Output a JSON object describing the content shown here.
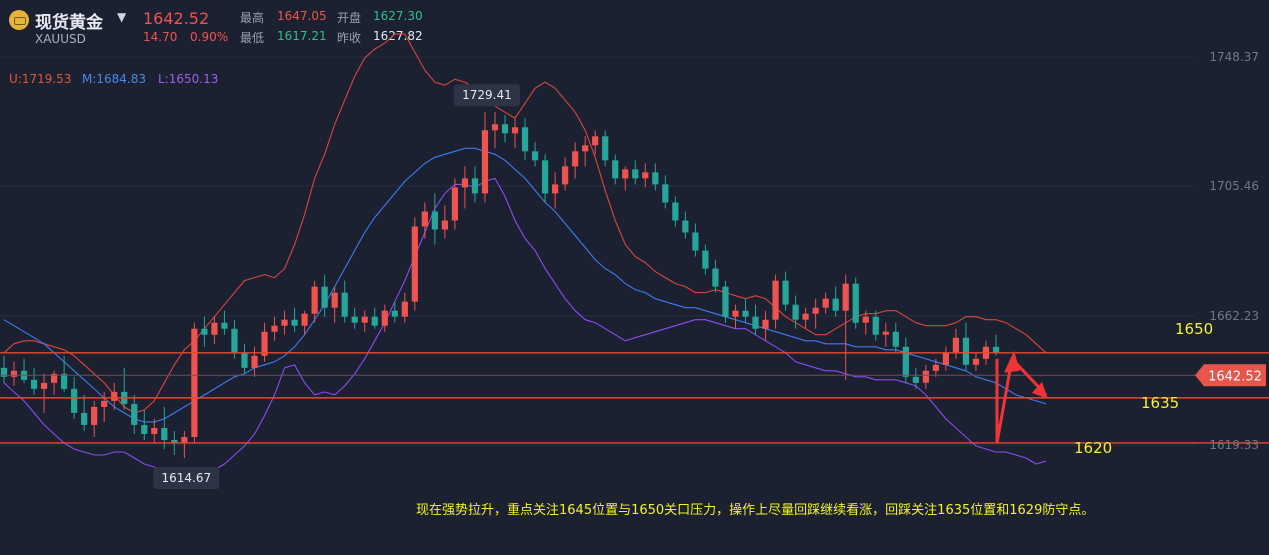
{
  "header": {
    "title": "现货黄金",
    "symbol": "XAUUSD",
    "price": "1642.52",
    "change": "14.70",
    "change_pct": "0.90%",
    "high_label": "最高",
    "high": "1647.05",
    "open_label": "开盘",
    "open": "1627.30",
    "low_label": "最低",
    "low": "1617.21",
    "prev_close_label": "昨收",
    "prev_close": "1627.82"
  },
  "boll": {
    "upper": "U:1719.53",
    "mid": "M:1684.83",
    "lower": "L:1650.13"
  },
  "colors": {
    "up": "#ef5350",
    "down": "#26a69a",
    "upper_band": "#d8473c",
    "mid_band": "#3c7cf0",
    "lower_band": "#8a4cf0",
    "annotation": "#f6f32a"
  },
  "callouts": {
    "max": "1729.41",
    "min": "1614.67"
  },
  "level_labels": {
    "l1650": "1650",
    "l1635": "1635",
    "l1620": "1620"
  },
  "price_tag": "1642.52",
  "note": "现在强势拉升，重点关注1645位置与1650关口压力，操作上尽量回踩继续看涨，回踩关注1635位置和1629防守点。",
  "chart_data": {
    "type": "candlestick",
    "yticks": [
      1748.37,
      1705.46,
      1662.23,
      1619.33
    ],
    "ytick_labels": [
      "1748.37",
      "1705.46",
      "1662.23",
      "1619.33"
    ],
    "ylim": [
      1603,
      1760
    ],
    "levels": [
      1650,
      1635,
      1620
    ],
    "last_price": 1642.52,
    "series": [
      {
        "name": "U",
        "values": [
          1650,
          1653,
          1654,
          1654,
          1653,
          1652,
          1651,
          1649,
          1646,
          1643,
          1640,
          1636,
          1632,
          1630,
          1631,
          1634,
          1640,
          1646,
          1651,
          1654,
          1658,
          1662,
          1666,
          1670,
          1674,
          1675,
          1676,
          1675,
          1678,
          1686,
          1696,
          1708,
          1716,
          1726,
          1734,
          1742,
          1748,
          1751,
          1753,
          1756,
          1756,
          1750,
          1744,
          1740,
          1739,
          1741,
          1740,
          1738,
          1735,
          1732,
          1730,
          1728,
          1733,
          1738,
          1740,
          1738,
          1734,
          1730,
          1724,
          1715,
          1704,
          1694,
          1686,
          1682,
          1680,
          1677,
          1675,
          1673,
          1672,
          1670,
          1670,
          1671,
          1670,
          1669,
          1668,
          1669,
          1668,
          1665,
          1662,
          1660,
          1658,
          1656,
          1656,
          1658,
          1660,
          1662,
          1663,
          1663,
          1664,
          1664,
          1662,
          1660,
          1659,
          1659,
          1659,
          1660,
          1662,
          1662,
          1661,
          1661,
          1660,
          1658,
          1656,
          1653,
          1650
        ]
      },
      {
        "name": "M",
        "values": [
          1661,
          1659,
          1657,
          1655,
          1653,
          1650,
          1647,
          1644,
          1641,
          1638,
          1635,
          1632,
          1630,
          1628,
          1627,
          1627,
          1628,
          1630,
          1632,
          1634,
          1636,
          1638,
          1640,
          1642,
          1643,
          1645,
          1646,
          1647,
          1649,
          1652,
          1656,
          1661,
          1666,
          1672,
          1678,
          1684,
          1690,
          1695,
          1699,
          1703,
          1707,
          1710,
          1713,
          1715,
          1716,
          1717,
          1718,
          1718,
          1717,
          1716,
          1714,
          1711,
          1708,
          1704,
          1700,
          1697,
          1693,
          1689,
          1685,
          1681,
          1678,
          1676,
          1673,
          1671,
          1670,
          1668,
          1667,
          1666,
          1665,
          1665,
          1664,
          1663,
          1662,
          1661,
          1660,
          1659,
          1658,
          1657,
          1656,
          1655,
          1654,
          1654,
          1653,
          1653,
          1653,
          1652,
          1652,
          1652,
          1651,
          1651,
          1650,
          1649,
          1648,
          1647,
          1646,
          1645,
          1644,
          1642,
          1641,
          1640,
          1638,
          1636,
          1635,
          1634,
          1633
        ]
      },
      {
        "name": "L",
        "values": [
          1640,
          1637,
          1634,
          1630,
          1626,
          1623,
          1620,
          1618,
          1617,
          1616,
          1616,
          1617,
          1617,
          1615,
          1613,
          1612,
          1611,
          1611,
          1610,
          1610,
          1610,
          1611,
          1613,
          1616,
          1619,
          1623,
          1629,
          1636,
          1645,
          1646,
          1640,
          1636,
          1637,
          1636,
          1639,
          1643,
          1648,
          1654,
          1660,
          1667,
          1674,
          1682,
          1690,
          1698,
          1703,
          1706,
          1706,
          1705,
          1707,
          1708,
          1702,
          1694,
          1688,
          1684,
          1678,
          1673,
          1668,
          1664,
          1661,
          1660,
          1658,
          1656,
          1654,
          1655,
          1656,
          1657,
          1658,
          1659,
          1660,
          1661,
          1661,
          1660,
          1659,
          1658,
          1658,
          1656,
          1654,
          1652,
          1650,
          1647,
          1646,
          1645,
          1644,
          1644,
          1643,
          1642,
          1642,
          1641,
          1641,
          1641,
          1640,
          1639,
          1636,
          1632,
          1628,
          1625,
          1622,
          1619,
          1618,
          1617,
          1617,
          1616,
          1615,
          1613,
          1614
        ]
      }
    ],
    "candles": [
      {
        "o": 1645,
        "h": 1649,
        "l": 1640,
        "c": 1642
      },
      {
        "o": 1642,
        "h": 1647,
        "l": 1639,
        "c": 1644
      },
      {
        "o": 1644,
        "h": 1648,
        "l": 1640,
        "c": 1641
      },
      {
        "o": 1641,
        "h": 1645,
        "l": 1636,
        "c": 1638
      },
      {
        "o": 1638,
        "h": 1643,
        "l": 1630,
        "c": 1640
      },
      {
        "o": 1640,
        "h": 1644,
        "l": 1636,
        "c": 1643
      },
      {
        "o": 1643,
        "h": 1649,
        "l": 1637,
        "c": 1638
      },
      {
        "o": 1638,
        "h": 1642,
        "l": 1628,
        "c": 1630
      },
      {
        "o": 1630,
        "h": 1636,
        "l": 1624,
        "c": 1626
      },
      {
        "o": 1626,
        "h": 1634,
        "l": 1622,
        "c": 1632
      },
      {
        "o": 1632,
        "h": 1637,
        "l": 1627,
        "c": 1634
      },
      {
        "o": 1634,
        "h": 1640,
        "l": 1631,
        "c": 1637
      },
      {
        "o": 1637,
        "h": 1645,
        "l": 1631,
        "c": 1633
      },
      {
        "o": 1633,
        "h": 1636,
        "l": 1623,
        "c": 1626
      },
      {
        "o": 1626,
        "h": 1631,
        "l": 1621,
        "c": 1623
      },
      {
        "o": 1623,
        "h": 1628,
        "l": 1620,
        "c": 1625
      },
      {
        "o": 1625,
        "h": 1632,
        "l": 1618,
        "c": 1621
      },
      {
        "o": 1621,
        "h": 1624,
        "l": 1616,
        "c": 1620
      },
      {
        "o": 1620,
        "h": 1624,
        "l": 1615,
        "c": 1622
      },
      {
        "o": 1622,
        "h": 1660,
        "l": 1620,
        "c": 1658
      },
      {
        "o": 1658,
        "h": 1662,
        "l": 1652,
        "c": 1656
      },
      {
        "o": 1656,
        "h": 1662,
        "l": 1653,
        "c": 1660
      },
      {
        "o": 1660,
        "h": 1664,
        "l": 1656,
        "c": 1658
      },
      {
        "o": 1658,
        "h": 1661,
        "l": 1648,
        "c": 1650
      },
      {
        "o": 1650,
        "h": 1653,
        "l": 1643,
        "c": 1645
      },
      {
        "o": 1645,
        "h": 1652,
        "l": 1642,
        "c": 1649
      },
      {
        "o": 1649,
        "h": 1660,
        "l": 1647,
        "c": 1657
      },
      {
        "o": 1657,
        "h": 1662,
        "l": 1654,
        "c": 1659
      },
      {
        "o": 1659,
        "h": 1664,
        "l": 1656,
        "c": 1661
      },
      {
        "o": 1661,
        "h": 1665,
        "l": 1657,
        "c": 1659
      },
      {
        "o": 1659,
        "h": 1664,
        "l": 1656,
        "c": 1663
      },
      {
        "o": 1663,
        "h": 1674,
        "l": 1660,
        "c": 1672
      },
      {
        "o": 1672,
        "h": 1676,
        "l": 1662,
        "c": 1665
      },
      {
        "o": 1665,
        "h": 1672,
        "l": 1660,
        "c": 1670
      },
      {
        "o": 1670,
        "h": 1674,
        "l": 1660,
        "c": 1662
      },
      {
        "o": 1662,
        "h": 1665,
        "l": 1658,
        "c": 1660
      },
      {
        "o": 1660,
        "h": 1664,
        "l": 1657,
        "c": 1662
      },
      {
        "o": 1662,
        "h": 1665,
        "l": 1658,
        "c": 1659
      },
      {
        "o": 1659,
        "h": 1666,
        "l": 1657,
        "c": 1664
      },
      {
        "o": 1664,
        "h": 1667,
        "l": 1660,
        "c": 1662
      },
      {
        "o": 1662,
        "h": 1670,
        "l": 1660,
        "c": 1667
      },
      {
        "o": 1667,
        "h": 1695,
        "l": 1664,
        "c": 1692
      },
      {
        "o": 1692,
        "h": 1700,
        "l": 1688,
        "c": 1697
      },
      {
        "o": 1697,
        "h": 1703,
        "l": 1686,
        "c": 1691
      },
      {
        "o": 1691,
        "h": 1699,
        "l": 1688,
        "c": 1694
      },
      {
        "o": 1694,
        "h": 1708,
        "l": 1691,
        "c": 1705
      },
      {
        "o": 1705,
        "h": 1712,
        "l": 1698,
        "c": 1708
      },
      {
        "o": 1708,
        "h": 1712,
        "l": 1700,
        "c": 1703
      },
      {
        "o": 1703,
        "h": 1730,
        "l": 1700,
        "c": 1724
      },
      {
        "o": 1724,
        "h": 1730,
        "l": 1718,
        "c": 1726
      },
      {
        "o": 1726,
        "h": 1729,
        "l": 1720,
        "c": 1723
      },
      {
        "o": 1723,
        "h": 1728,
        "l": 1718,
        "c": 1725
      },
      {
        "o": 1725,
        "h": 1728,
        "l": 1714,
        "c": 1717
      },
      {
        "o": 1717,
        "h": 1720,
        "l": 1712,
        "c": 1714
      },
      {
        "o": 1714,
        "h": 1716,
        "l": 1700,
        "c": 1703
      },
      {
        "o": 1703,
        "h": 1710,
        "l": 1698,
        "c": 1706
      },
      {
        "o": 1706,
        "h": 1715,
        "l": 1704,
        "c": 1712
      },
      {
        "o": 1712,
        "h": 1720,
        "l": 1708,
        "c": 1717
      },
      {
        "o": 1717,
        "h": 1722,
        "l": 1712,
        "c": 1719
      },
      {
        "o": 1719,
        "h": 1724,
        "l": 1716,
        "c": 1722
      },
      {
        "o": 1722,
        "h": 1724,
        "l": 1712,
        "c": 1714
      },
      {
        "o": 1714,
        "h": 1716,
        "l": 1706,
        "c": 1708
      },
      {
        "o": 1708,
        "h": 1712,
        "l": 1704,
        "c": 1711
      },
      {
        "o": 1711,
        "h": 1714,
        "l": 1706,
        "c": 1708
      },
      {
        "o": 1708,
        "h": 1713,
        "l": 1705,
        "c": 1710
      },
      {
        "o": 1710,
        "h": 1713,
        "l": 1704,
        "c": 1706
      },
      {
        "o": 1706,
        "h": 1709,
        "l": 1698,
        "c": 1700
      },
      {
        "o": 1700,
        "h": 1702,
        "l": 1692,
        "c": 1694
      },
      {
        "o": 1694,
        "h": 1697,
        "l": 1688,
        "c": 1690
      },
      {
        "o": 1690,
        "h": 1693,
        "l": 1682,
        "c": 1684
      },
      {
        "o": 1684,
        "h": 1686,
        "l": 1676,
        "c": 1678
      },
      {
        "o": 1678,
        "h": 1681,
        "l": 1670,
        "c": 1672
      },
      {
        "o": 1672,
        "h": 1674,
        "l": 1660,
        "c": 1662
      },
      {
        "o": 1662,
        "h": 1666,
        "l": 1658,
        "c": 1664
      },
      {
        "o": 1664,
        "h": 1668,
        "l": 1660,
        "c": 1662
      },
      {
        "o": 1662,
        "h": 1666,
        "l": 1656,
        "c": 1658
      },
      {
        "o": 1658,
        "h": 1664,
        "l": 1654,
        "c": 1661
      },
      {
        "o": 1661,
        "h": 1676,
        "l": 1658,
        "c": 1674
      },
      {
        "o": 1674,
        "h": 1677,
        "l": 1664,
        "c": 1666
      },
      {
        "o": 1666,
        "h": 1669,
        "l": 1658,
        "c": 1661
      },
      {
        "o": 1661,
        "h": 1665,
        "l": 1658,
        "c": 1663
      },
      {
        "o": 1663,
        "h": 1668,
        "l": 1658,
        "c": 1665
      },
      {
        "o": 1665,
        "h": 1670,
        "l": 1663,
        "c": 1668
      },
      {
        "o": 1668,
        "h": 1672,
        "l": 1662,
        "c": 1664
      },
      {
        "o": 1664,
        "h": 1676,
        "l": 1641,
        "c": 1673
      },
      {
        "o": 1673,
        "h": 1675,
        "l": 1658,
        "c": 1660
      },
      {
        "o": 1660,
        "h": 1664,
        "l": 1656,
        "c": 1662
      },
      {
        "o": 1662,
        "h": 1664,
        "l": 1654,
        "c": 1656
      },
      {
        "o": 1656,
        "h": 1660,
        "l": 1652,
        "c": 1657
      },
      {
        "o": 1657,
        "h": 1660,
        "l": 1650,
        "c": 1652
      },
      {
        "o": 1652,
        "h": 1655,
        "l": 1640,
        "c": 1642
      },
      {
        "o": 1642,
        "h": 1645,
        "l": 1638,
        "c": 1640
      },
      {
        "o": 1640,
        "h": 1646,
        "l": 1638,
        "c": 1644
      },
      {
        "o": 1644,
        "h": 1648,
        "l": 1642,
        "c": 1646
      },
      {
        "o": 1646,
        "h": 1652,
        "l": 1644,
        "c": 1650
      },
      {
        "o": 1650,
        "h": 1658,
        "l": 1648,
        "c": 1655
      },
      {
        "o": 1655,
        "h": 1660,
        "l": 1644,
        "c": 1646
      },
      {
        "o": 1646,
        "h": 1650,
        "l": 1644,
        "c": 1648
      },
      {
        "o": 1648,
        "h": 1654,
        "l": 1646,
        "c": 1652
      },
      {
        "o": 1652,
        "h": 1656,
        "l": 1649,
        "c": 1650
      }
    ]
  }
}
